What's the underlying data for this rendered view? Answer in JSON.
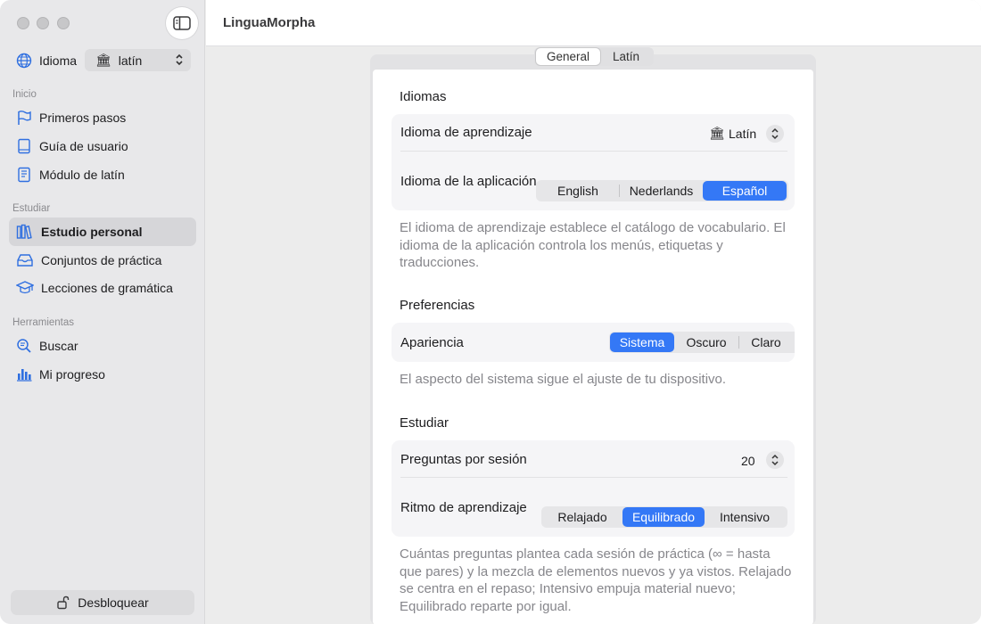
{
  "window": {
    "title": "LinguaMorpha"
  },
  "sidebar": {
    "language_label": "Idioma",
    "language_value": "latín",
    "sections": [
      {
        "title": "Inicio",
        "items": [
          {
            "label": "Primeros pasos",
            "icon": "flag-icon"
          },
          {
            "label": "Guía de usuario",
            "icon": "book-icon"
          },
          {
            "label": "Módulo de latín",
            "icon": "document-icon"
          }
        ]
      },
      {
        "title": "Estudiar",
        "items": [
          {
            "label": "Estudio personal",
            "icon": "books-icon",
            "selected": true
          },
          {
            "label": "Conjuntos de práctica",
            "icon": "tray-icon"
          },
          {
            "label": "Lecciones de gramática",
            "icon": "graduation-cap-icon"
          }
        ]
      },
      {
        "title": "Herramientas",
        "items": [
          {
            "label": "Buscar",
            "icon": "search-icon"
          },
          {
            "label": "Mi progreso",
            "icon": "bar-chart-icon"
          }
        ]
      }
    ],
    "unlock_label": "Desbloquear"
  },
  "tabs": [
    {
      "label": "General",
      "active": true
    },
    {
      "label": "Latín",
      "active": false
    }
  ],
  "groups": {
    "idiomas": {
      "title": "Idiomas",
      "learning_language_label": "Idioma de aprendizaje",
      "learning_language_value": "Latín",
      "app_language_label": "Idioma de la aplicación",
      "app_language_options": [
        "English",
        "Nederlands",
        "Español"
      ],
      "app_language_selected": "Español",
      "description": "El idioma de aprendizaje establece el catálogo de vocabulario. El idioma de la aplicación controla los menús, etiquetas y traducciones."
    },
    "preferencias": {
      "title": "Preferencias",
      "appearance_label": "Apariencia",
      "appearance_options": [
        "Sistema",
        "Oscuro",
        "Claro"
      ],
      "appearance_selected": "Sistema",
      "description": "El aspecto del sistema sigue el ajuste de tu dispositivo."
    },
    "estudiar": {
      "title": "Estudiar",
      "questions_label": "Preguntas por sesión",
      "questions_value": "20",
      "pace_label": "Ritmo de aprendizaje",
      "pace_options": [
        "Relajado",
        "Equilibrado",
        "Intensivo"
      ],
      "pace_selected": "Equilibrado",
      "description": "Cuántas preguntas plantea cada sesión de práctica (∞ = hasta que pares) y la mezcla de elementos nuevos y ya vistos. Relajado se centra en el repaso; Intensivo empuja material nuevo; Equilibrado reparte por igual."
    }
  },
  "colors": {
    "accent": "#3478f6",
    "sidebar_icon": "#2f6fe0"
  }
}
